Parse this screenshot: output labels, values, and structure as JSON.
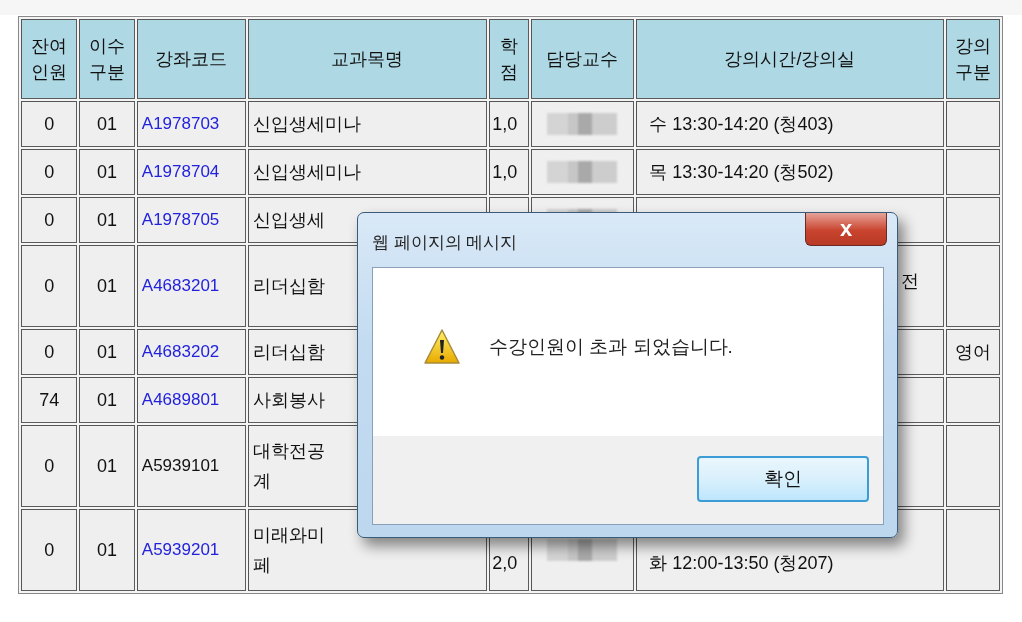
{
  "table": {
    "columns": [
      "잔여인원",
      "이수구분",
      "강좌코드",
      "교과목명",
      "학점",
      "담당교수",
      "강의시간/강의실",
      "강의구분"
    ],
    "rows": [
      {
        "remaining": "0",
        "category": "01",
        "code": "A1978703",
        "code_link": true,
        "subject": "신입생세미나",
        "credits": "1,0",
        "professor_blurred": true,
        "time": "수 13:30-14:20 (청403)",
        "wrapped": false
      },
      {
        "remaining": "0",
        "category": "01",
        "code": "A1978704",
        "code_link": true,
        "subject": "신입생세미나",
        "credits": "1,0",
        "professor_blurred": true,
        "time": "목 13:30-14:20 (청502)",
        "wrapped": false
      },
      {
        "remaining": "0",
        "category": "01",
        "code": "A1978705",
        "code_link": true,
        "subject": "신입생세",
        "professor_blurred": true,
        "wrapped": false
      },
      {
        "remaining": "0",
        "category": "01",
        "code": "A4683201",
        "code_link": true,
        "subject": "리더십함",
        "time_fragment": "전",
        "wrapped": true
      },
      {
        "remaining": "0",
        "category": "01",
        "code": "A4683202",
        "code_link": true,
        "subject": "리더십함",
        "lecture_type": "영어",
        "wrapped": false
      },
      {
        "remaining": "74",
        "category": "01",
        "code": "A4689801",
        "code_link": true,
        "subject": "사회봉사",
        "wrapped": false
      },
      {
        "remaining": "0",
        "category": "01",
        "code": "A5939101",
        "code_link": false,
        "subject": "대학전공\n계",
        "wrapped": true
      },
      {
        "remaining": "0",
        "category": "01",
        "code": "A5939201",
        "code_link": true,
        "subject": "미래와미\n페",
        "credits": "2,0",
        "professor_blurred": true,
        "time": "화 12:00-13:50 (청207)",
        "wrapped": true
      }
    ]
  },
  "dialog": {
    "title": "웹 페이지의 메시지",
    "close": "x",
    "message": "수강인원이 초과 되었습니다.",
    "button": "확인"
  }
}
